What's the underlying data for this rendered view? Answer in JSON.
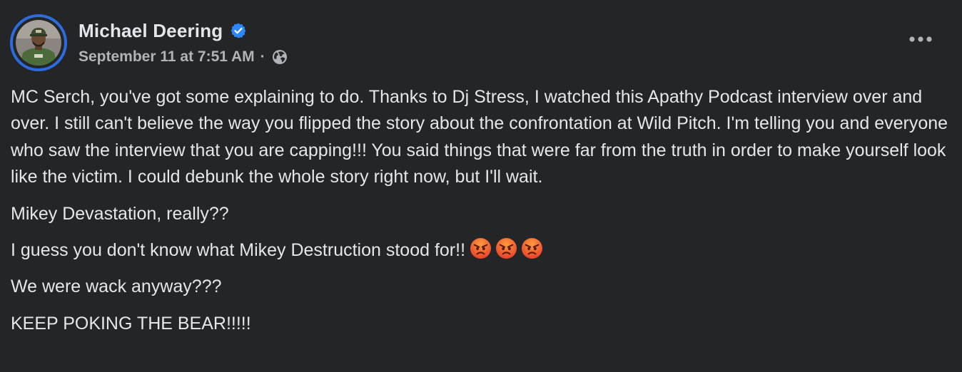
{
  "post": {
    "author": "Michael Deering",
    "verified": true,
    "timestamp": "September 11 at 7:51 AM",
    "separator": "·",
    "audience_icon": "globe-icon",
    "more_icon": "more-options-icon",
    "accent_color": "#2d6cdf",
    "paragraphs": [
      "MC Serch, you've got some explaining to do. Thanks to Dj Stress, I watched this Apathy Podcast interview over and over. I still can't believe the way you flipped the story about the confrontation at Wild Pitch. I'm telling you and everyone who saw the interview that you are capping!!! You said things that were far from the truth in order to make yourself look like the victim. I could debunk the whole story right now, but I'll wait.",
      "Mikey Devastation, really??",
      "I guess you don't know what Mikey Destruction stood for!!",
      "We were wack anyway???",
      "KEEP POKING THE BEAR!!!!!"
    ],
    "emojis": [
      "angry-face-emoji",
      "angry-face-emoji",
      "angry-face-emoji"
    ]
  }
}
